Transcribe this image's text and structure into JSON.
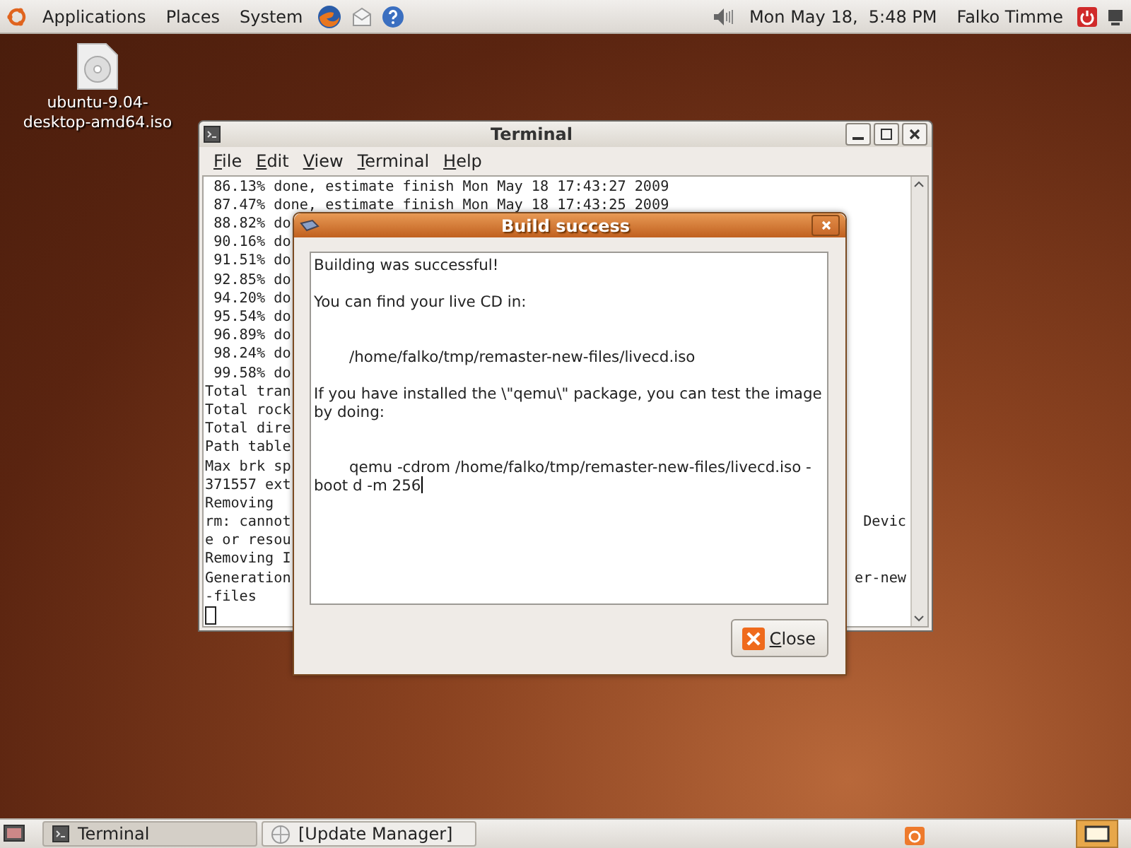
{
  "top_panel": {
    "menus": [
      "Applications",
      "Places",
      "System"
    ],
    "clock": "Mon May 18,  5:48 PM",
    "user": "Falko Timme"
  },
  "desktop_icons": [
    {
      "label": "ubuntu-9.04-desktop-amd64.iso"
    }
  ],
  "terminal": {
    "title": "Terminal",
    "menu": [
      "File",
      "Edit",
      "View",
      "Terminal",
      "Help"
    ],
    "lines": [
      {
        "left": " 86.13% done, estimate finish Mon May 18 17:43:27 2009"
      },
      {
        "left": " 87.47% done, estimate finish Mon May 18 17:43:25 2009"
      },
      {
        "left": " 88.82% do"
      },
      {
        "left": " 90.16% do"
      },
      {
        "left": " 91.51% do"
      },
      {
        "left": " 92.85% do"
      },
      {
        "left": " 94.20% do"
      },
      {
        "left": " 95.54% do"
      },
      {
        "left": " 96.89% do"
      },
      {
        "left": " 98.24% do"
      },
      {
        "left": " 99.58% do"
      },
      {
        "left": "Total tran"
      },
      {
        "left": "Total rock"
      },
      {
        "left": "Total dire"
      },
      {
        "left": "Path table"
      },
      {
        "left": "Max brk sp"
      },
      {
        "left": "371557 ext"
      },
      {
        "left": "Removing"
      },
      {
        "left": "rm: cannot",
        "right": "Devic"
      },
      {
        "left": "e or resou"
      },
      {
        "left": "Removing I"
      },
      {
        "left": "Generation",
        "right": "er-new"
      },
      {
        "left": "-files"
      }
    ]
  },
  "dialog": {
    "title": "Build success",
    "paragraphs": [
      {
        "kind": "text",
        "text": "Building was successful!"
      },
      {
        "kind": "text",
        "text": "You can find your live CD in:"
      },
      {
        "kind": "indent",
        "text": "/home/falko/tmp/remaster-new-files/livecd.iso"
      },
      {
        "kind": "text",
        "text": "If you have installed the \\\"qemu\\\" package, you can test the image by doing:"
      },
      {
        "kind": "indent",
        "text": "qemu -cdrom /home/falko/tmp/remaster-new-files/livecd.iso -boot d -m 256"
      }
    ],
    "button": "Close"
  },
  "taskbar": {
    "tasks": [
      {
        "label": "Terminal",
        "selected": true
      },
      {
        "label": "[Update Manager]",
        "selected": false
      }
    ]
  }
}
